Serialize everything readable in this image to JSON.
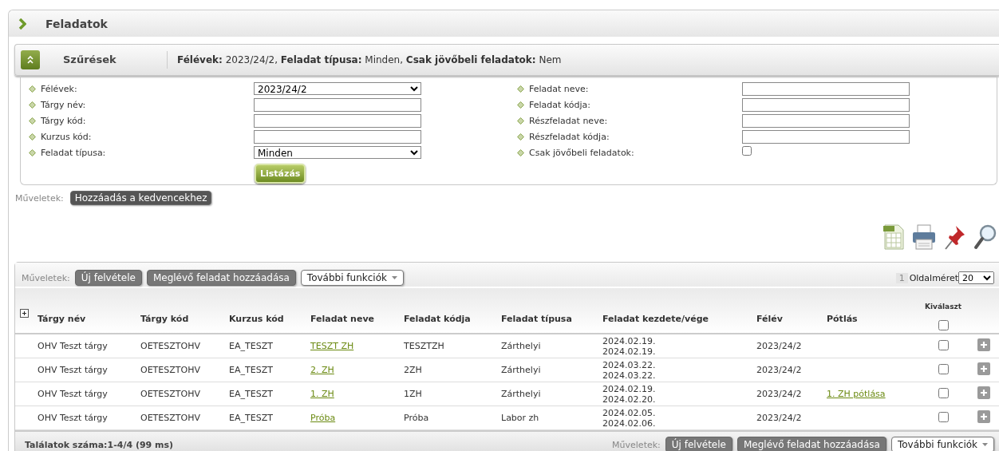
{
  "page": {
    "title": "Feladatok"
  },
  "filters": {
    "title": "Szűrések",
    "summary": "**Félévek:** 2023/24/2, **Feladat típusa:** Minden, **Csak jövőbeli feladatok:** Nem",
    "left_fields": [
      {
        "label": "Félévek:",
        "kind": "select",
        "value": "2023/24/2"
      },
      {
        "label": "Tárgy név:",
        "kind": "text"
      },
      {
        "label": "Tárgy kód:",
        "kind": "text"
      },
      {
        "label": "Kurzus kód:",
        "kind": "text"
      },
      {
        "label": "Feladat típusa:",
        "kind": "select",
        "value": "Minden"
      }
    ],
    "right_fields": [
      {
        "label": "Feladat neve:",
        "kind": "text"
      },
      {
        "label": "Feladat kódja:",
        "kind": "text"
      },
      {
        "label": "Részfeladat neve:",
        "kind": "text"
      },
      {
        "label": "Részfeladat kódja:",
        "kind": "text"
      },
      {
        "label": "Csak jövőbeli feladatok:",
        "kind": "checkbox",
        "checked": false
      }
    ],
    "submit": "Listázás"
  },
  "actions": {
    "label": "Műveletek:",
    "buttons": [
      "Hozzáadás a kedvencekhez"
    ]
  },
  "table": {
    "actions_label": "Műveletek:",
    "buttons": [
      {
        "label": "Új felvétele",
        "kind": "dark"
      },
      {
        "label": "Meglévő feladat hozzáadása",
        "kind": "dark"
      },
      {
        "label": "További funkciók",
        "kind": "menu"
      }
    ],
    "page_number": "1",
    "page_size_label": "Oldalméret",
    "page_size": "20",
    "columns": [
      "Tárgy név",
      "Tárgy kód",
      "Kurzus kód",
      "Feladat neve",
      "Feladat kódja",
      "Feladat típusa",
      "Feladat kezdete/vége",
      "Félév",
      "Pótlás"
    ],
    "select_header": "Kiválaszt",
    "select_all": false,
    "rows": [
      {
        "subject": "OHV Teszt tárgy",
        "subject_code": "OETESZTOHV",
        "course_code": "EA_TESZT",
        "task": "TESZT ZH",
        "task_code": "TESZTZH",
        "type": "Zárthelyi",
        "start": "2024.02.19.",
        "end": "2024.02.19.",
        "term": "2023/24/2",
        "retake": "",
        "selected": false
      },
      {
        "subject": "OHV Teszt tárgy",
        "subject_code": "OETESZTOHV",
        "course_code": "EA_TESZT",
        "task": "2. ZH",
        "task_code": "2ZH",
        "type": "Zárthelyi",
        "start": "2024.03.22.",
        "end": "2024.03.22.",
        "term": "2023/24/2",
        "retake": "",
        "selected": false
      },
      {
        "subject": "OHV Teszt tárgy",
        "subject_code": "OETESZTOHV",
        "course_code": "EA_TESZT",
        "task": "1. ZH",
        "task_code": "1ZH",
        "type": "Zárthelyi",
        "start": "2024.02.19.",
        "end": "2024.02.20.",
        "term": "2023/24/2",
        "retake": "1. ZH pótlása",
        "selected": false
      },
      {
        "subject": "OHV Teszt tárgy",
        "subject_code": "OETESZTOHV",
        "course_code": "EA_TESZT",
        "task": "Próba",
        "task_code": "Próba",
        "type": "Labor zh",
        "start": "2024.02.05.",
        "end": "2024.02.06.",
        "term": "2023/24/2",
        "retake": "",
        "selected": false
      }
    ],
    "footer": {
      "count": "Találatok száma:1-4/4 (99 ms)",
      "actions_label": "Műveletek:",
      "buttons": [
        {
          "label": "Új felvétele",
          "kind": "dark"
        },
        {
          "label": "Meglévő feladat hozzáadása",
          "kind": "dark"
        },
        {
          "label": "További funkciók",
          "kind": "menu"
        }
      ]
    }
  }
}
